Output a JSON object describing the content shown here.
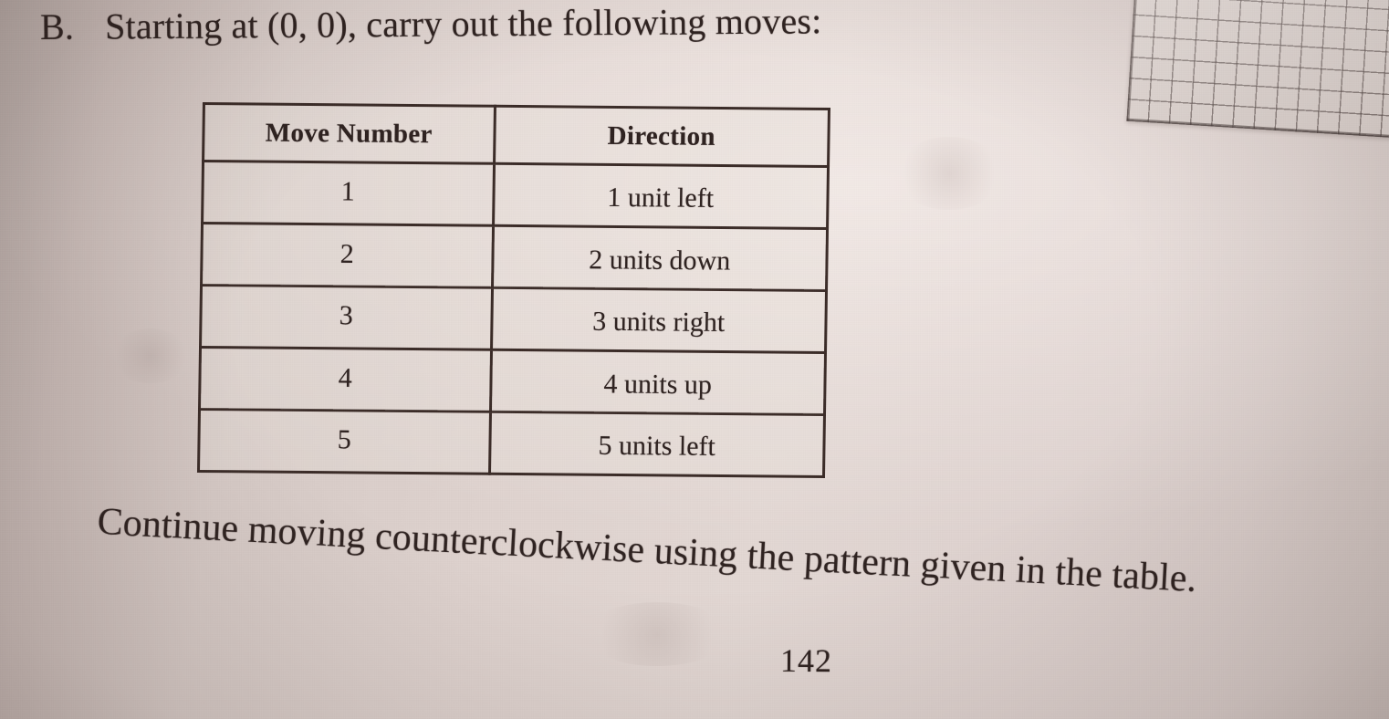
{
  "document": {
    "page_number": "142",
    "prompt": {
      "label": "B.",
      "text": "Starting at (0, 0), carry out the following moves:"
    },
    "caption": "Continue moving counterclockwise using the pattern given in the table."
  },
  "moves_table": {
    "headers": [
      "Move Number",
      "Direction"
    ],
    "rows": [
      {
        "move": "1",
        "direction": "1 unit left"
      },
      {
        "move": "2",
        "direction": "2 units down"
      },
      {
        "move": "3",
        "direction": "3 units right"
      },
      {
        "move": "4",
        "direction": "4 units up"
      },
      {
        "move": "5",
        "direction": "5 units left"
      }
    ]
  },
  "decorations": {
    "graph_paper_scrap": "graph-paper-icon"
  },
  "colors": {
    "paper": "#ded2ce",
    "paper_shadow": "#b2a5a1",
    "ink": "#2e2220",
    "rule": "#3a2b27",
    "grid_line": "#463a38"
  }
}
